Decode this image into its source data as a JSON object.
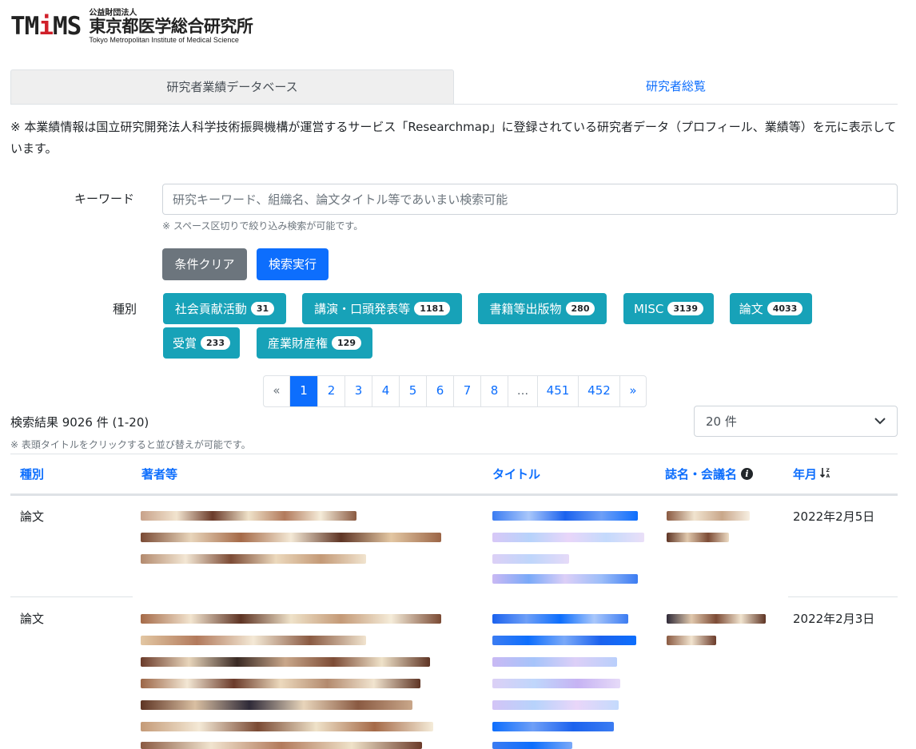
{
  "logo": {
    "mark": "TMiMS",
    "mark_pre": "TM",
    "mark_i": "i",
    "mark_post": "MS",
    "org_type": "公益財団法人",
    "org_name": "東京都医学総合研究所",
    "org_name_en": "Tokyo Metropolitan Institute of Medical Science"
  },
  "tabs": [
    {
      "label": "研究者業績データベース",
      "active": true
    },
    {
      "label": "研究者総覧",
      "active": false
    }
  ],
  "notice": "※ 本業績情報は国立研究開発法人科学技術振興機構が運営するサービス「Researchmap」に登録されている研究者データ（プロフィール、業績等）を元に表示しています。",
  "search": {
    "keyword_label": "キーワード",
    "placeholder": "研究キーワード、組織名、論文タイトル等であいまい検索可能",
    "value": "",
    "hint": "※ スペース区切りで絞り込み検索が可能です。",
    "clear_label": "条件クリア",
    "submit_label": "検索実行"
  },
  "categories": {
    "label": "種別",
    "items": [
      {
        "label": "社会貢献活動",
        "count": "31"
      },
      {
        "label": "講演・口頭発表等",
        "count": "1181"
      },
      {
        "label": "書籍等出版物",
        "count": "280"
      },
      {
        "label": "MISC",
        "count": "3139"
      },
      {
        "label": "論文",
        "count": "4033"
      },
      {
        "label": "受賞",
        "count": "233"
      },
      {
        "label": "産業財産権",
        "count": "129"
      }
    ]
  },
  "pagination": {
    "prev": "«",
    "next": "»",
    "pages": [
      "1",
      "2",
      "3",
      "4",
      "5",
      "6",
      "7",
      "8",
      "...",
      "451",
      "452"
    ],
    "current": "1"
  },
  "results": {
    "summary": "検索結果 9026 件 (1-20)",
    "sort_hint": "※ 表頭タイトルをクリックすると並び替えが可能です。",
    "per_page": "20 件"
  },
  "table": {
    "headers": {
      "type": "種別",
      "authors": "著者等",
      "title": "タイトル",
      "journal": "誌名・会議名",
      "date": "年月"
    },
    "rows": [
      {
        "type": "論文",
        "date": "2022年2月5日"
      },
      {
        "type": "論文",
        "date": "2022年2月3日"
      }
    ]
  },
  "colors": {
    "primary": "#0d6efd",
    "secondary": "#6c757d",
    "chip": "#17a2b8",
    "logo_accent": "#d0202a"
  },
  "icons": {
    "info": "info-circle-icon",
    "sort": "sort-desc-icon",
    "select": "chevron-down-icon"
  }
}
